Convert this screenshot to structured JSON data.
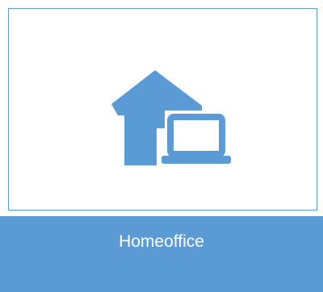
{
  "tile": {
    "label": "Homeoffice",
    "icon": "homeoffice-icon",
    "accent_color": "#5b9bd5",
    "label_text_color": "#ffffff"
  }
}
